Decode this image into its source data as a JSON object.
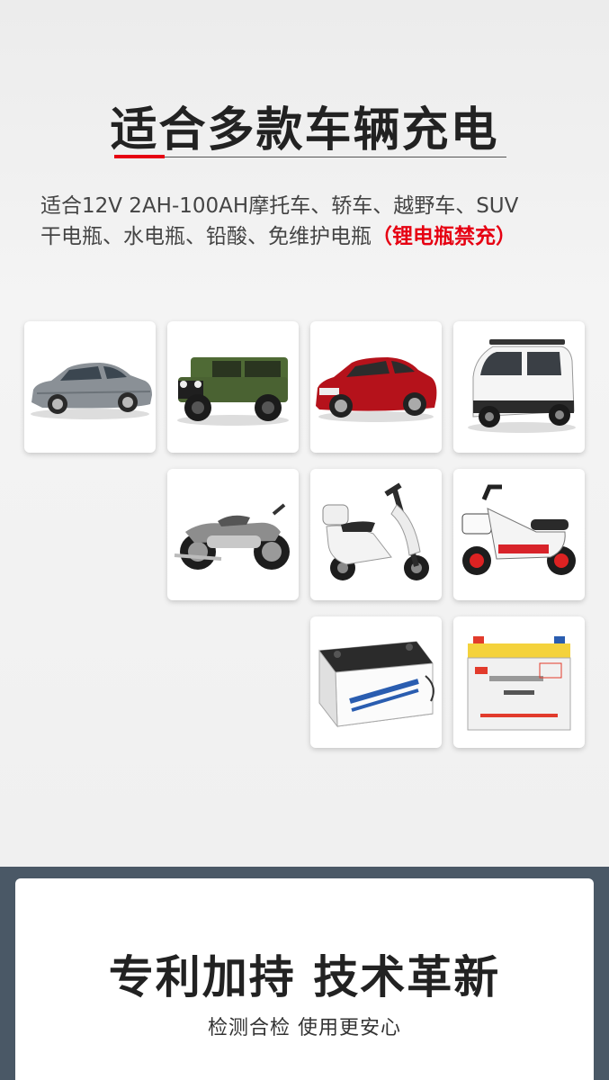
{
  "header": {
    "title": "适合多款车辆充电",
    "accent_color": "#e60012"
  },
  "description": {
    "line1": "适合12V 2AH-100AH摩托车、轿车、越野车、SUV",
    "line2_text": "干电瓶、水电瓶、铅酸、免维护电瓶",
    "line2_warning": "（锂电瓶禁充）"
  },
  "gallery": {
    "items": [
      {
        "icon": "sedan-car-icon"
      },
      {
        "icon": "jeep-offroad-icon"
      },
      {
        "icon": "suv-icon"
      },
      {
        "icon": "mini-electric-car-icon"
      },
      {
        "icon": "motorcycle-icon"
      },
      {
        "icon": "scooter-icon"
      },
      {
        "icon": "electric-bike-icon"
      },
      {
        "icon": "lead-acid-battery-icon"
      },
      {
        "icon": "maintenance-free-battery-icon"
      }
    ]
  },
  "feature": {
    "title": "专利加持 技术革新",
    "subtitle": "检测合检 使用更安心",
    "bg_color": "#4a5866"
  }
}
